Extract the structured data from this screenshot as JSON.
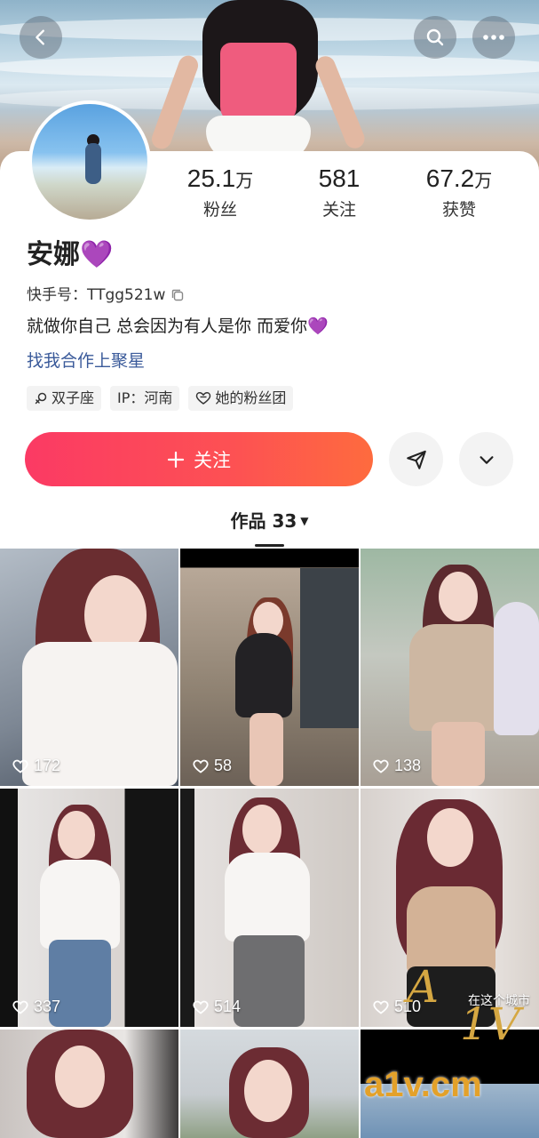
{
  "profile": {
    "name": "安娜",
    "name_emoji": "💜",
    "kuaishou_id_label": "快手号：",
    "kuaishou_id": "TTgg521w",
    "bio": "就做你自己 总会因为有人是你 而爱你",
    "bio_emoji": "💜",
    "collab_link": "找我合作上聚星"
  },
  "stats": {
    "fans": {
      "value": "25.1",
      "unit": "万",
      "label": "粉丝"
    },
    "following": {
      "value": "581",
      "unit": "",
      "label": "关注"
    },
    "likes": {
      "value": "67.2",
      "unit": "万",
      "label": "获赞"
    }
  },
  "tags": [
    {
      "icon": "gemini-icon",
      "label": "双子座"
    },
    {
      "icon": "",
      "label": "IP：河南"
    },
    {
      "icon": "fan-club-icon",
      "label": "她的粉丝团"
    }
  ],
  "actions": {
    "follow_label": "关注"
  },
  "works": {
    "tab_label": "作品 33"
  },
  "videos": [
    {
      "likes": "172"
    },
    {
      "likes": "58"
    },
    {
      "likes": "138"
    },
    {
      "likes": "337"
    },
    {
      "likes": "514"
    },
    {
      "likes": "510",
      "caption": "在这个城市"
    },
    {
      "likes": ""
    },
    {
      "likes": ""
    },
    {
      "likes": ""
    }
  ],
  "watermark": {
    "logo_a": "A",
    "logo_b": "1V",
    "url": "a1v.cm"
  },
  "colors": {
    "follow_gradient_start": "#fb3a64",
    "follow_gradient_end": "#fe6b3e",
    "link_blue": "#3a5a9a",
    "heart_purple": "#9b4fd9",
    "watermark_gold": "#d5a742"
  }
}
